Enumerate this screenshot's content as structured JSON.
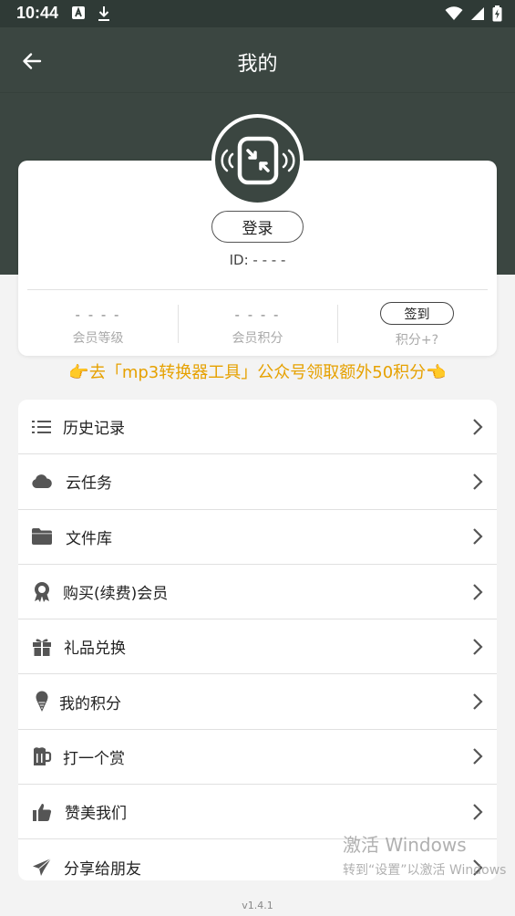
{
  "status_bar": {
    "time": "10:44"
  },
  "appbar": {
    "title": "我的"
  },
  "profile": {
    "login_label": "登录",
    "id_text": "ID: - - - -",
    "stats": [
      {
        "value": "- - - -",
        "label": "会员等级"
      },
      {
        "value": "- - - -",
        "label": "会员积分"
      },
      {
        "button": "签到",
        "label": "积分+?"
      }
    ]
  },
  "promo": "👉去「mp3转换器工具」公众号领取额外50积分👈",
  "menu": [
    {
      "label": "历史记录",
      "icon": "list-icon"
    },
    {
      "label": "云任务",
      "icon": "cloud-icon"
    },
    {
      "label": "文件库",
      "icon": "folder-icon"
    },
    {
      "label": "购买(续费)会员",
      "icon": "award-icon"
    },
    {
      "label": "礼品兑换",
      "icon": "gift-icon"
    },
    {
      "label": "我的积分",
      "icon": "ice-cream-icon"
    },
    {
      "label": "打一个赏",
      "icon": "beer-mug-icon"
    },
    {
      "label": "赞美我们",
      "icon": "thumbs-up-icon"
    },
    {
      "label": "分享给朋友",
      "icon": "paper-plane-icon"
    }
  ],
  "watermark": {
    "line1": "激活 Windows",
    "line2": "转到“设置”以激活 Windows"
  },
  "version": "v1.4.1",
  "colors": {
    "header": "#3b4641",
    "promo": "#e6a100",
    "background": "#f3f3f3"
  }
}
